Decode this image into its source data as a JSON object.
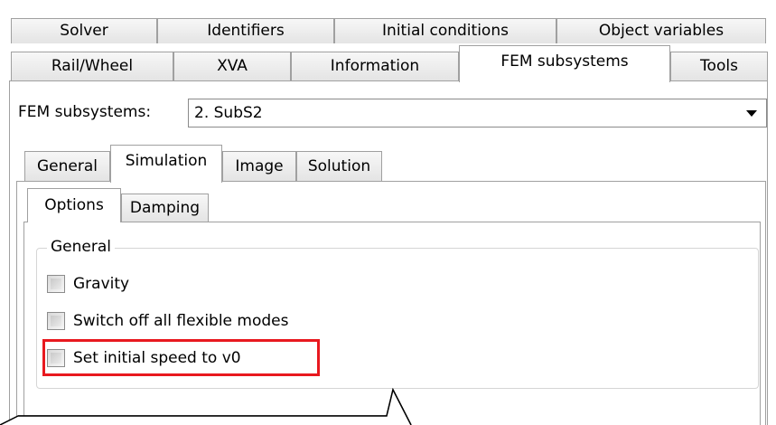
{
  "main_tabs": {
    "row1": [
      "Solver",
      "Identifiers",
      "Initial conditions",
      "Object variables"
    ],
    "row2": [
      "Rail/Wheel",
      "XVA",
      "Information",
      "FEM subsystems",
      "Tools"
    ],
    "active": "FEM subsystems"
  },
  "fem_selector": {
    "label": "FEM subsystems:",
    "value": "2. SubS2"
  },
  "sub_tabs": {
    "items": [
      "General",
      "Simulation",
      "Image",
      "Solution"
    ],
    "active": "Simulation"
  },
  "inner_tabs": {
    "items": [
      "Options",
      "Damping"
    ],
    "active": "Options"
  },
  "group": {
    "title": "General",
    "checkboxes": [
      {
        "label": "Gravity",
        "checked": false
      },
      {
        "label": "Switch off all flexible modes",
        "checked": false
      },
      {
        "label": "Set initial speed to v0",
        "checked": false,
        "highlighted": true
      }
    ]
  },
  "colors": {
    "highlight": "#e8191f",
    "border": "#a0a0a0"
  }
}
